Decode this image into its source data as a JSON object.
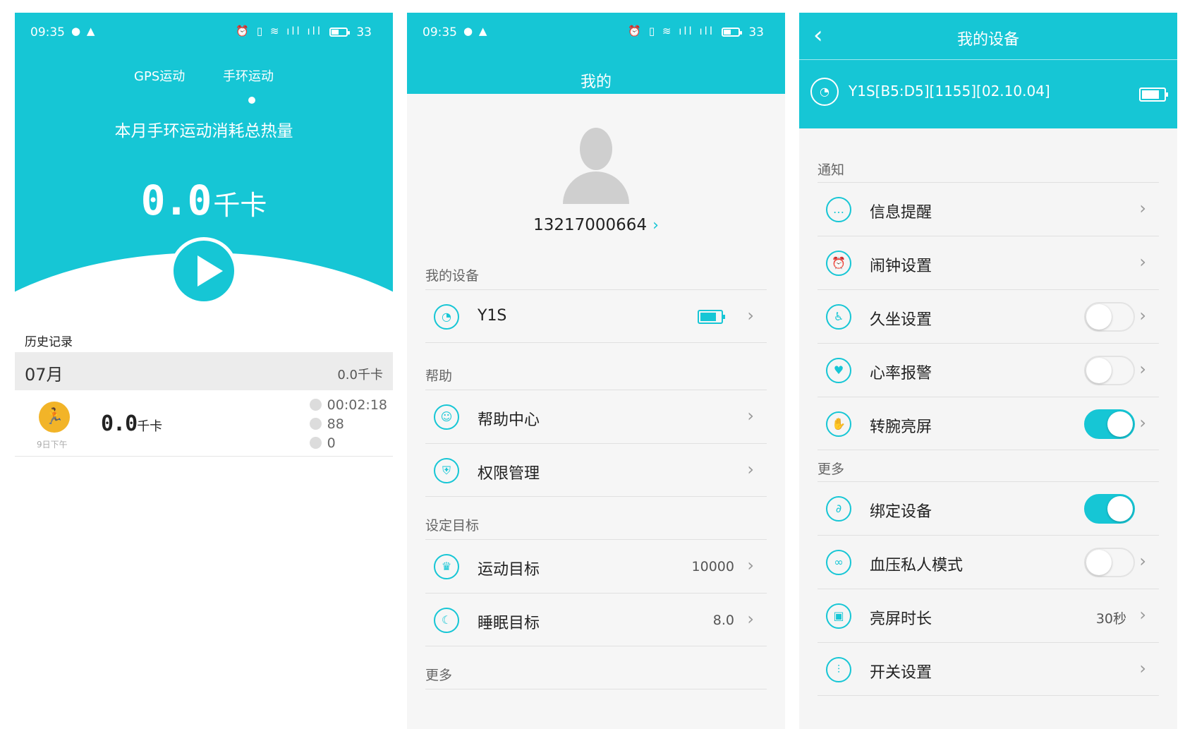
{
  "colors": {
    "accent": "#16c6d5",
    "run_icon": "#f2b428"
  },
  "status": {
    "time": "09:35",
    "battery": "33"
  },
  "screen1": {
    "tabs": [
      "GPS运动",
      "手环运动"
    ],
    "subtitle": "本月手环运动消耗总热量",
    "total_value": "0.0",
    "total_unit": "千卡",
    "history_label": "历史记录",
    "month": {
      "label": "07月",
      "kcal": "0.0千卡"
    },
    "record": {
      "date": "9日下午",
      "value": "0.0",
      "unit": "千卡",
      "duration": "00:02:18",
      "heart": "88",
      "steps": "0"
    }
  },
  "screen2": {
    "title": "我的",
    "phone": "13217000664",
    "sections": {
      "devices": "我的设备",
      "help": "帮助",
      "goals": "设定目标",
      "more": "更多"
    },
    "device_name": "Y1S",
    "help_items": [
      "帮助中心",
      "权限管理"
    ],
    "goals": [
      {
        "label": "运动目标",
        "value": "10000"
      },
      {
        "label": "睡眠目标",
        "value": "8.0"
      }
    ]
  },
  "screen3": {
    "title": "我的设备",
    "device": "Y1S[B5:D5][1155][02.10.04]",
    "sections": {
      "notify": "通知",
      "more": "更多"
    },
    "notify_items": [
      {
        "label": "信息提醒",
        "icon": "message-icon",
        "toggle": null
      },
      {
        "label": "闹钟设置",
        "icon": "alarm-icon",
        "toggle": null
      },
      {
        "label": "久坐设置",
        "icon": "sedentary-icon",
        "toggle": false
      },
      {
        "label": "心率报警",
        "icon": "heart-rate-icon",
        "toggle": false
      },
      {
        "label": "转腕亮屏",
        "icon": "wrist-icon",
        "toggle": true
      }
    ],
    "more_items": [
      {
        "label": "绑定设备",
        "icon": "bind-icon",
        "toggle": true
      },
      {
        "label": "血压私人模式",
        "icon": "blood-pressure-icon",
        "toggle": false
      },
      {
        "label": "亮屏时长",
        "icon": "screen-time-icon",
        "value": "30秒"
      },
      {
        "label": "开关设置",
        "icon": "switch-settings-icon",
        "toggle": null
      }
    ]
  }
}
